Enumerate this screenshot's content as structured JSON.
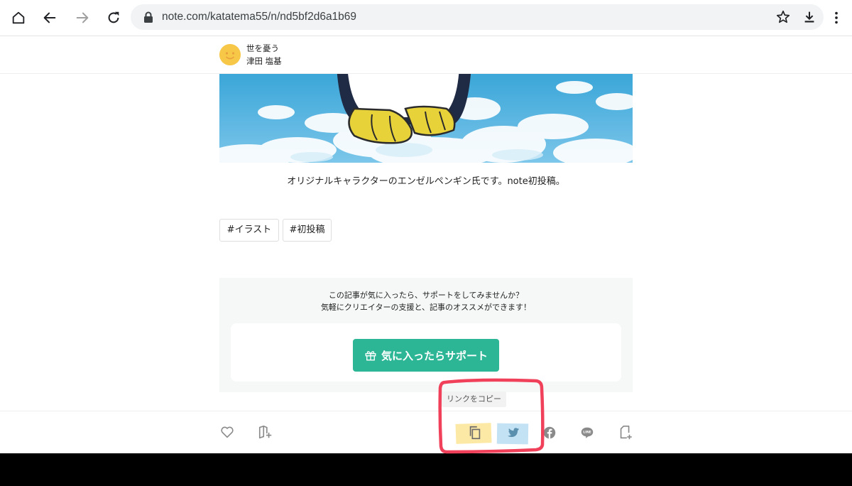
{
  "browser": {
    "url": "note.com/katatema55/n/nd5bf2d6a1b69",
    "icons": [
      "home-icon",
      "back-icon",
      "forward-icon",
      "reload-icon",
      "lock-icon",
      "star-icon",
      "download-icon",
      "more-vert-icon"
    ]
  },
  "article": {
    "magazine_name": "世を憂う",
    "author_name": "津田 塩基",
    "caption": "オリジナルキャラクターのエンゼルペンギン氏です。note初投稿。",
    "tags": [
      "#イラスト",
      "#初投稿"
    ]
  },
  "support": {
    "message_line1": "この記事が気に入ったら、サポートをしてみませんか？",
    "message_line2": "気軽にクリエイターの支援と、記事のオススメができます！",
    "button_label": "気に入ったらサポート",
    "accent_color": "#2cb696"
  },
  "share": {
    "tooltip": "リンクをコピー",
    "icons": [
      "heart-icon",
      "magazine-add-icon",
      "copy-link-icon",
      "twitter-icon",
      "facebook-icon",
      "line-icon",
      "note-add-icon"
    ],
    "annotation_color": "#f0405a"
  }
}
